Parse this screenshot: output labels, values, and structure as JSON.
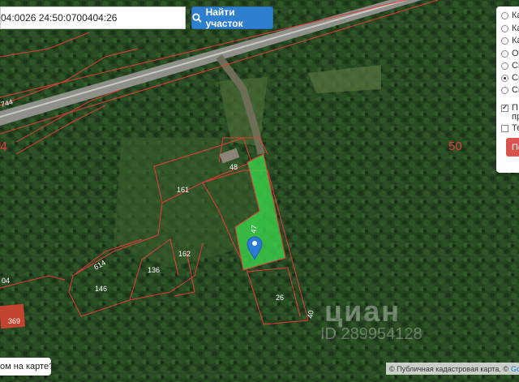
{
  "search": {
    "value": "04:0026 24:50:0700404:26",
    "button_label": "Найти участок"
  },
  "panel": {
    "options": [
      {
        "label": "Ка",
        "checked": false
      },
      {
        "label": "Ка",
        "checked": false
      },
      {
        "label": "Ка",
        "checked": false
      },
      {
        "label": "Ор",
        "checked": false
      },
      {
        "label": "Сп",
        "checked": false
      },
      {
        "label": "Сп",
        "checked": true
      },
      {
        "label": "Сп",
        "checked": false
      }
    ],
    "checkbox_1": {
      "label": "П",
      "sublabel": "пр",
      "checked": true
    },
    "checkbox_2": {
      "label": "Те",
      "checked": false
    },
    "button_label": "По"
  },
  "map": {
    "parcel_labels": {
      "p744": "744",
      "p48": "48",
      "p161": "161",
      "p47": "47",
      "p162": "162",
      "p614": "614",
      "p136": "136",
      "p146": "146",
      "p26": "26",
      "p40": "40",
      "p369": "369",
      "p04": "04",
      "p50": "50",
      "p4": "4"
    },
    "bubble_text": "ом на карте?",
    "attribution_text": "© Публичная кадастровая карта, ©",
    "attribution_google": "Googl",
    "watermark": "циан",
    "watermark_id": "ID 289954128"
  },
  "colors": {
    "forest": "#23421f",
    "road": "#9a9a92",
    "boundary": "#e23b3b",
    "selected_parcel": "#39d24a",
    "marker": "#2a7ad8",
    "button_blue": "#2f7fcf",
    "button_red": "#d9534f"
  }
}
